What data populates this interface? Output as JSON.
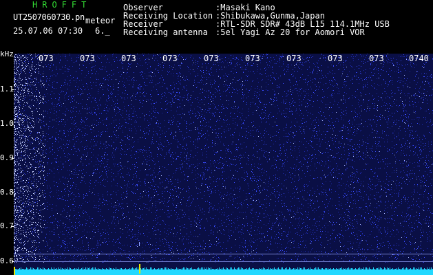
{
  "header": {
    "brand": "HROFFT",
    "filename": "UT2507060730.pn",
    "meteor_label": "meteor",
    "datetime": "25.07.06 07:30",
    "signal_value": "6._"
  },
  "meta": [
    {
      "key": "Observer",
      "value": ":Masaki Kano"
    },
    {
      "key": "Receiving Location",
      "value": ":Shibukawa,Gunma,Japan"
    },
    {
      "key": "Receiver",
      "value": ":RTL-SDR SDR# 43dB L15 114.1MHz USB"
    },
    {
      "key": "Receiving antenna",
      "value": ":5el Yagi Az 20 for Aomori VOR"
    }
  ],
  "y_axis": {
    "unit": "kHz",
    "ticks": [
      "1.1",
      "1.0",
      "0.9",
      "0.8",
      "0.7",
      "0.6"
    ]
  },
  "time_labels": [
    "073",
    "073",
    "073",
    "073",
    "073",
    "073",
    "073",
    "073",
    "073",
    "0740"
  ],
  "colors": {
    "background": "#000000",
    "spectrum_bg": "#0a0f45",
    "noise": "#3a4cff",
    "baseline": "#22d8ff",
    "brand_green": "#33dd33",
    "marker_yellow": "#e8e800"
  }
}
